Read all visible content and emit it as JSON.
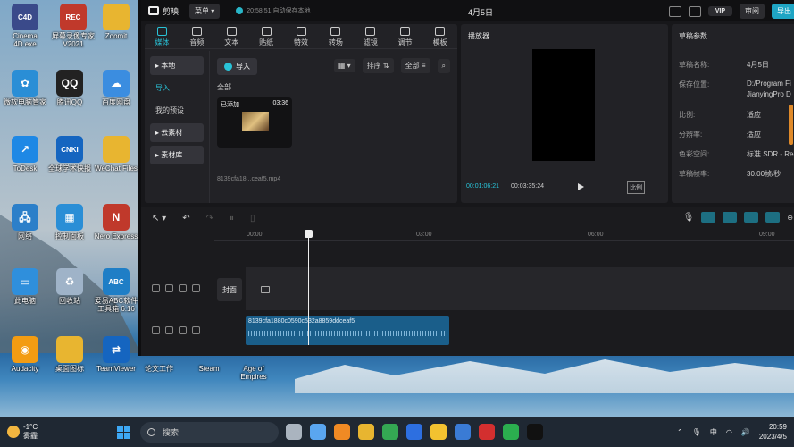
{
  "desktop": {
    "icons": [
      {
        "label": "Cinema 4D.exe",
        "icon": "cinema4d-icon",
        "color": "#3a4a8a",
        "glyph": "C4D"
      },
      {
        "label": "屏幕录像专家 V2021",
        "icon": "screen-recorder-icon",
        "color": "#c0392b",
        "glyph": "REC"
      },
      {
        "label": "Zoomit",
        "icon": "folder-icon",
        "color": "#e8b530",
        "glyph": ""
      },
      {
        "label": "微软电脑管家",
        "icon": "pc-manager-icon",
        "color": "#2a8ed6",
        "glyph": "✿"
      },
      {
        "label": "腾讯QQ",
        "icon": "qq-penguin-icon",
        "color": "#222",
        "glyph": "QQ"
      },
      {
        "label": "百度网盘",
        "icon": "baidu-netdisk-icon",
        "color": "#3b8de0",
        "glyph": "☁"
      },
      {
        "label": "ToDesk",
        "icon": "todesk-icon",
        "color": "#1e88e5",
        "glyph": "↗"
      },
      {
        "label": "全球学术快报",
        "icon": "cnki-icon",
        "color": "#1565c0",
        "glyph": "CNKI"
      },
      {
        "label": "WeChat Files",
        "icon": "folder-icon",
        "color": "#e8b530",
        "glyph": ""
      },
      {
        "label": "网络",
        "icon": "network-icon",
        "color": "#2c7fc9",
        "glyph": "🖧"
      },
      {
        "label": "控制面板",
        "icon": "control-panel-icon",
        "color": "#2a8ed6",
        "glyph": "▦"
      },
      {
        "label": "Nero Express",
        "icon": "nero-icon",
        "color": "#c0392b",
        "glyph": "N"
      },
      {
        "label": "此电脑",
        "icon": "this-pc-icon",
        "color": "#2f8fdc",
        "glyph": "▭"
      },
      {
        "label": "回收站",
        "icon": "recycle-bin-icon",
        "color": "#9fb3c8",
        "glyph": "♻"
      },
      {
        "label": "爱易ABC软件工具箱 6.16",
        "icon": "abc-toolbox-icon",
        "color": "#1f7ec6",
        "glyph": "ABC"
      },
      {
        "label": "Audacity",
        "icon": "audacity-icon",
        "color": "#f39c12",
        "glyph": "◉"
      },
      {
        "label": "桌面图标",
        "icon": "folder-icon",
        "color": "#e8b530",
        "glyph": ""
      },
      {
        "label": "TeamViewer",
        "icon": "teamviewer-icon",
        "color": "#1565c0",
        "glyph": "⇄"
      },
      {
        "label": "论文工作",
        "icon": "folder-icon",
        "color": "#e8b530",
        "glyph": ""
      },
      {
        "label": "Steam",
        "icon": "steam-icon",
        "color": "#2a3f5a",
        "glyph": "⚙"
      },
      {
        "label": "Age of Empires",
        "icon": "age-of-empires-icon",
        "color": "#8a5a2a",
        "glyph": "⚔"
      }
    ]
  },
  "editor": {
    "app_name": "剪映",
    "menu_label": "菜单",
    "save_status": "20:58:51 自动保存本地",
    "project_title": "4月5日",
    "vip_label": "VIP",
    "review_label": "审阅",
    "export_label": "导出",
    "tools": [
      {
        "label": "媒体",
        "icon": "media-icon",
        "active": true
      },
      {
        "label": "音频",
        "icon": "audio-icon"
      },
      {
        "label": "文本",
        "icon": "text-icon"
      },
      {
        "label": "贴纸",
        "icon": "sticker-icon"
      },
      {
        "label": "特效",
        "icon": "effects-icon"
      },
      {
        "label": "转场",
        "icon": "transition-icon"
      },
      {
        "label": "滤镜",
        "icon": "filter-icon"
      },
      {
        "label": "调节",
        "icon": "adjust-icon"
      },
      {
        "label": "模板",
        "icon": "template-icon"
      }
    ],
    "nav": {
      "local": "本地",
      "import": "导入",
      "presets": "我的预设",
      "cloud": "云素材",
      "library": "素材库"
    },
    "media": {
      "import_label": "导入",
      "sort_label": "排序",
      "filter_label": "全部",
      "all_label": "全部",
      "clip_added": "已添加",
      "clip_duration": "03:36",
      "clip_name": "8139cfa18...ceaf5.mp4"
    },
    "player": {
      "title": "播放器",
      "current_time": "00:01:06:21",
      "total_time": "00:03:35:24",
      "ratio_label": "比例"
    },
    "params": {
      "title": "草稿参数",
      "rows": [
        {
          "label": "草稿名称:",
          "value": "4月5日"
        },
        {
          "label": "保存位置:",
          "value": "D:/Program Fi"
        },
        {
          "label": "",
          "value": "JianyingPro D"
        },
        {
          "label": "比例:",
          "value": "适应"
        },
        {
          "label": "分辨率:",
          "value": "适应"
        },
        {
          "label": "色彩空间:",
          "value": "标准 SDR - Rec"
        },
        {
          "label": "草稿帧率:",
          "value": "30.00帧/秒"
        }
      ]
    },
    "timeline": {
      "ticks": [
        "00:00",
        "03:00",
        "06:00",
        "09:00"
      ],
      "cover_label": "封面",
      "audio_clip_name": "8139cfa1880c0590c532a8859ddceaf5"
    }
  },
  "taskbar": {
    "temperature": "-1°C",
    "weather": "雾霾",
    "search_label": "搜索",
    "ime": "中",
    "time": "20:59",
    "date": "2023/4/5",
    "apps": [
      {
        "icon": "file-explorer-icon",
        "color": "#aab4bf"
      },
      {
        "icon": "lightbulb-icon",
        "color": "#5aa6f0"
      },
      {
        "icon": "search-app-icon",
        "color": "#f08a24"
      },
      {
        "icon": "folder-taskbar-icon",
        "color": "#e8b530"
      },
      {
        "icon": "chrome-icon",
        "color": "#34a853"
      },
      {
        "icon": "k-app-icon",
        "color": "#2d6fe0"
      },
      {
        "icon": "sticky-notes-icon",
        "color": "#f2c230"
      },
      {
        "icon": "app-store-icon",
        "color": "#3a7bd5"
      },
      {
        "icon": "record-icon",
        "color": "#d32f2f"
      },
      {
        "icon": "wechat-icon",
        "color": "#2bae4f"
      },
      {
        "icon": "capcut-icon",
        "color": "#111"
      }
    ]
  }
}
